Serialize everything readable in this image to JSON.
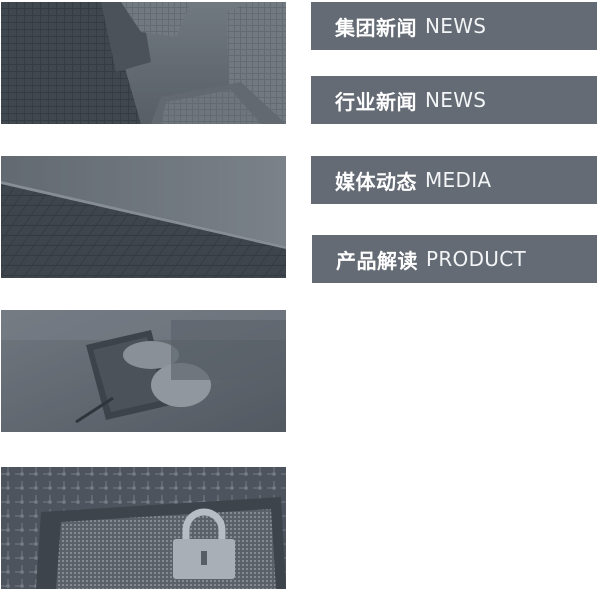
{
  "categories": [
    {
      "zh": "集团新闻",
      "en": "NEWS"
    },
    {
      "zh": "行业新闻",
      "en": "NEWS"
    },
    {
      "zh": "媒体动态",
      "en": "MEDIA"
    },
    {
      "zh": "产品解读",
      "en": "PRODUCT"
    }
  ],
  "tiles": [
    {
      "icon": "skyscrapers-image"
    },
    {
      "icon": "solar-panels-image"
    },
    {
      "icon": "tablet-hands-image"
    },
    {
      "icon": "circuit-lock-image"
    }
  ],
  "colors": {
    "button_bg": "#646b74",
    "button_text": "#ffffff",
    "image_tint": "#4a525b"
  }
}
